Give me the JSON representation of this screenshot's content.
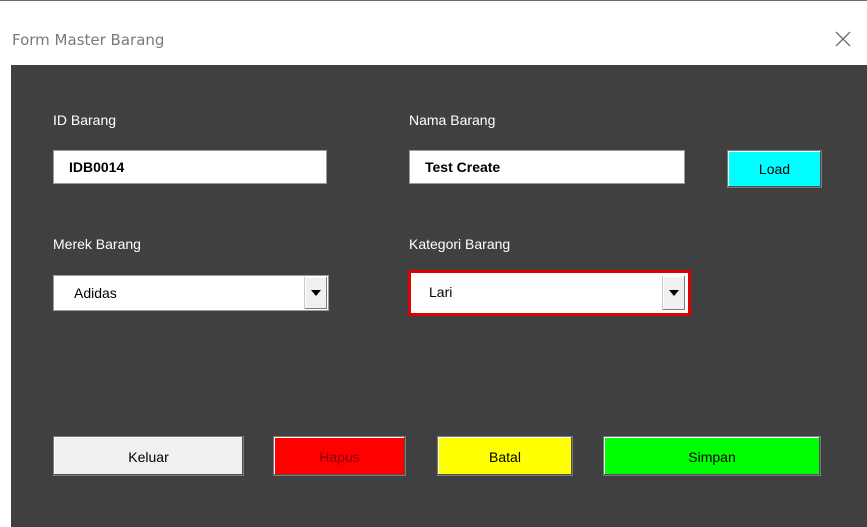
{
  "window": {
    "title": "Form Master Barang"
  },
  "fields": {
    "id_barang": {
      "label": "ID Barang",
      "value": "IDB0014"
    },
    "nama_barang": {
      "label": "Nama Barang",
      "value": "Test Create"
    },
    "merek_barang": {
      "label": "Merek Barang",
      "value": "Adidas"
    },
    "kategori_barang": {
      "label": "Kategori Barang",
      "value": "Lari"
    }
  },
  "buttons": {
    "load": "Load",
    "keluar": "Keluar",
    "hapus": "Hapus",
    "batal": "Batal",
    "simpan": "Simpan"
  },
  "icons": {
    "close": "close-icon",
    "dropdown": "triangle-down-icon"
  },
  "colors": {
    "client_background": "#404040",
    "load": "#00ffff",
    "hapus": "#ff0000",
    "batal": "#ffff00",
    "simpan": "#00ff00",
    "keluar": "#f0f0f0",
    "focus_border": "#e00000"
  }
}
